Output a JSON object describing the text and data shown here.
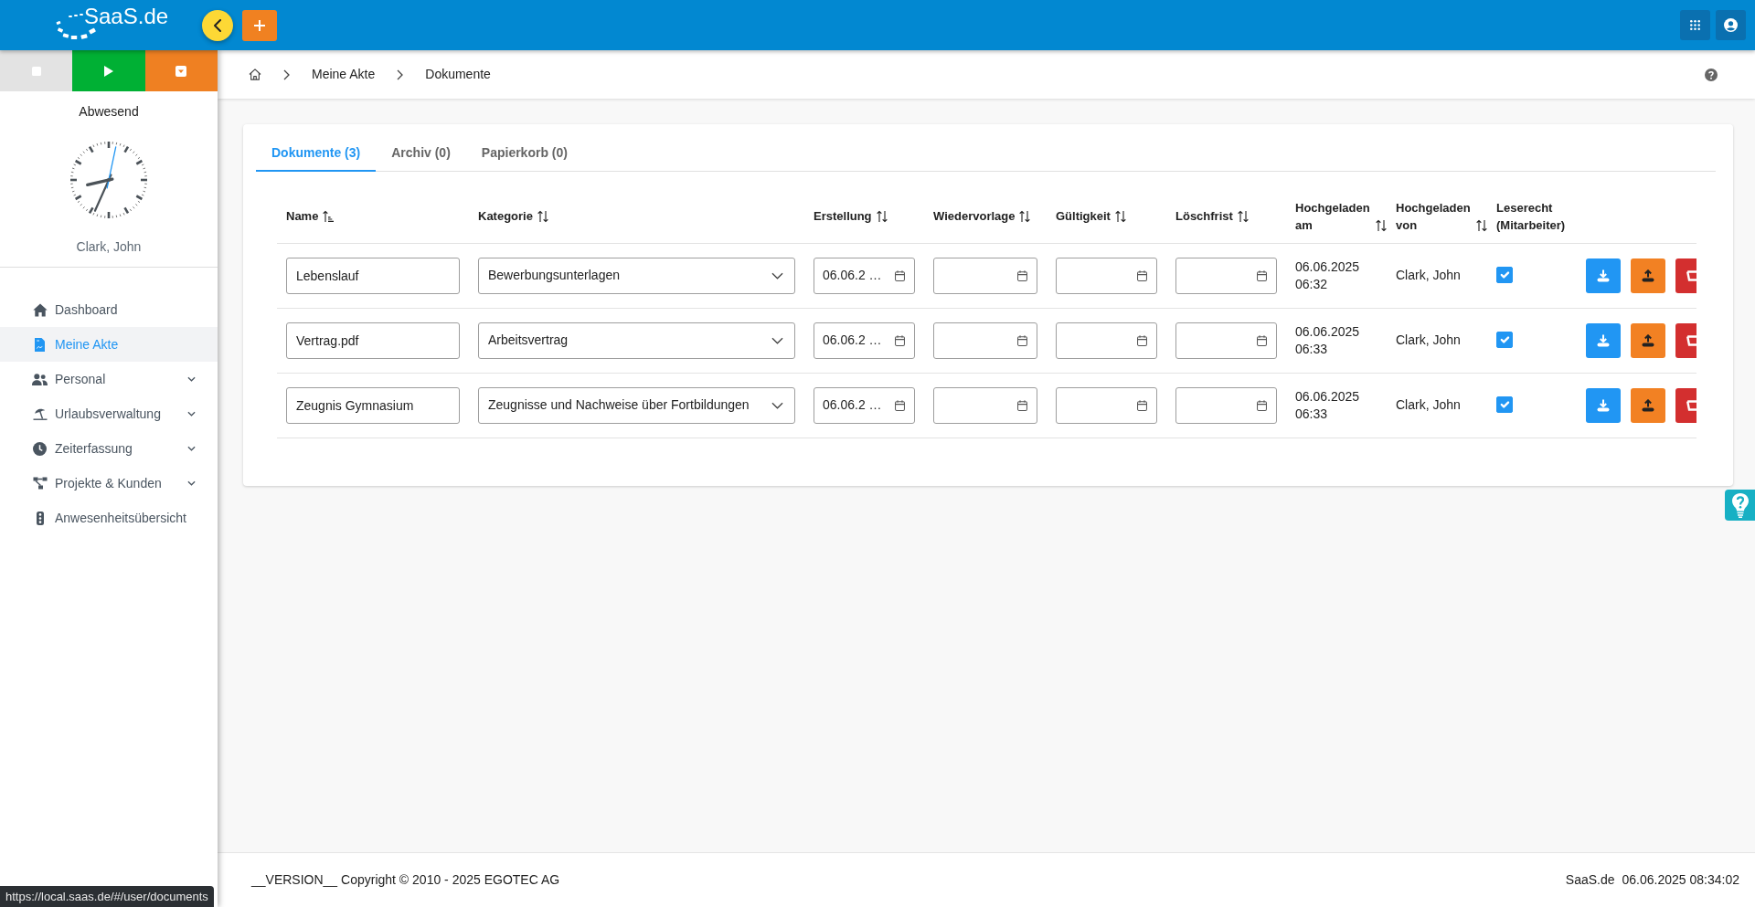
{
  "header": {
    "logo": "SaaS.de"
  },
  "sidebar": {
    "status": "Abwesend",
    "user_name": "Clark, John",
    "items": [
      {
        "label": "Dashboard",
        "kind": "link",
        "selected": false
      },
      {
        "label": "Meine Akte",
        "kind": "link",
        "selected": true
      },
      {
        "label": "Personal",
        "kind": "group",
        "selected": false
      },
      {
        "label": "Urlaubsverwaltung",
        "kind": "group",
        "selected": false
      },
      {
        "label": "Zeiterfassung",
        "kind": "group",
        "selected": false
      },
      {
        "label": "Projekte & Kunden",
        "kind": "group",
        "selected": false
      },
      {
        "label": "Anwesenheitsübersicht",
        "kind": "link",
        "selected": false
      }
    ]
  },
  "breadcrumb": [
    "Meine Akte",
    "Dokumente"
  ],
  "tabs": [
    {
      "label": "Dokumente (3)",
      "selected": true
    },
    {
      "label": "Archiv (0)",
      "selected": false
    },
    {
      "label": "Papierkorb (0)",
      "selected": false
    }
  ],
  "table": {
    "columns": [
      {
        "label": "Name",
        "kind": "sorted"
      },
      {
        "label": "Kategorie",
        "kind": "sortable"
      },
      {
        "label": "Erstellung",
        "kind": "sortable"
      },
      {
        "label": "Wiedervorlage",
        "kind": "sortable"
      },
      {
        "label": "Gültigkeit",
        "kind": "sortable"
      },
      {
        "label": "Löschfrist",
        "kind": "sortable"
      },
      {
        "label": "Hochgeladen am",
        "kind": "sortable"
      },
      {
        "label": "Hochgeladen von",
        "kind": "sortable"
      },
      {
        "label": "Leserecht (Mitarbeiter)",
        "kind": "plain"
      }
    ],
    "rows": [
      {
        "name": "Lebenslauf",
        "category": "Bewerbungsunterlagen",
        "created": "06.06.2 …",
        "uploaded_at": "06.06.2025 06:32",
        "uploaded_by": "Clark, John",
        "read_access": true
      },
      {
        "name": "Vertrag.pdf",
        "category": "Arbeitsvertrag",
        "created": "06.06.2 …",
        "uploaded_at": "06.06.2025 06:33",
        "uploaded_by": "Clark, John",
        "read_access": true
      },
      {
        "name": "Zeugnis Gymnasium",
        "category": "Zeugnisse und Nachweise über Fortbildungen",
        "created": "06.06.2 …",
        "uploaded_at": "06.06.2025 06:33",
        "uploaded_by": "Clark, John",
        "read_access": true
      }
    ]
  },
  "footer": {
    "copyright": "__VERSION__ Copyright © 2010 - 2025 EGOTEC AG",
    "app_name": "SaaS.de",
    "timestamp": "06.06.2025 08:34:02"
  },
  "status_url": "https://local.saas.de/#/user/documents"
}
